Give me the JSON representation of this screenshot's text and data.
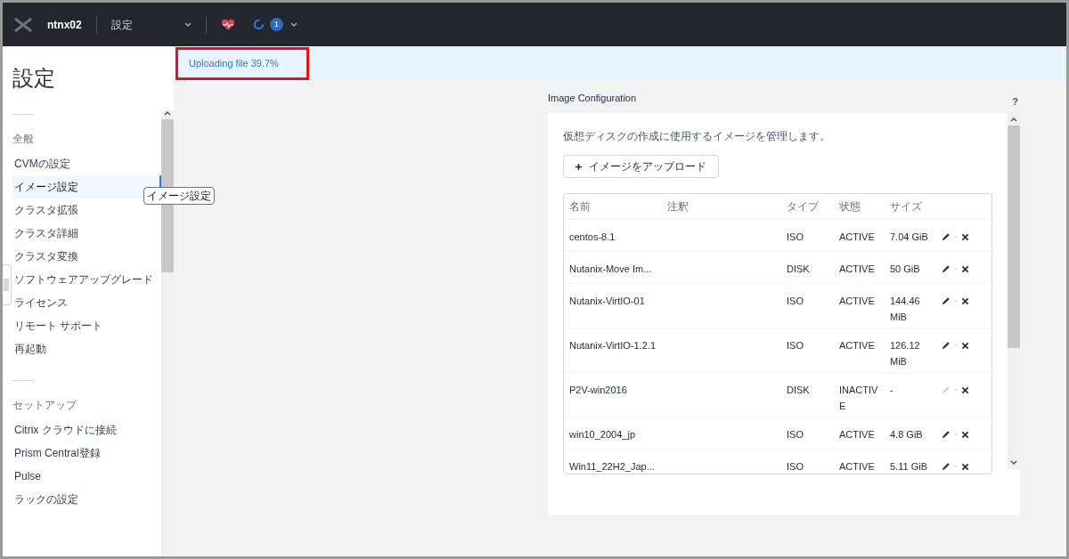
{
  "topbar": {
    "cluster": "ntnx02",
    "page": "設定",
    "alerts_count": "1"
  },
  "banner": {
    "text": "Uploading file 39.7%"
  },
  "sidebar": {
    "title": "設定",
    "tooltip": "イメージ設定",
    "sections": [
      {
        "heading": "全般",
        "items": [
          {
            "label": "CVMの設定",
            "selected": false
          },
          {
            "label": "イメージ設定",
            "selected": true
          },
          {
            "label": "クラスタ拡張",
            "selected": false
          },
          {
            "label": "クラスタ詳細",
            "selected": false
          },
          {
            "label": "クラスタ変換",
            "selected": false
          },
          {
            "label": "ソフトウェアアップグレード",
            "selected": false
          },
          {
            "label": "ライセンス",
            "selected": false
          },
          {
            "label": "リモート サポート",
            "selected": false
          },
          {
            "label": "再起動",
            "selected": false
          }
        ]
      },
      {
        "heading": "セットアップ",
        "items": [
          {
            "label": "Citrix クラウドに接続",
            "selected": false
          },
          {
            "label": "Prism Central登録",
            "selected": false
          },
          {
            "label": "Pulse",
            "selected": false
          },
          {
            "label": "ラックの設定",
            "selected": false
          }
        ]
      }
    ]
  },
  "panel": {
    "title": "Image Configuration",
    "help": "?",
    "description": "仮想ディスクの作成に使用するイメージを管理します。",
    "upload_button": "イメージをアップロード",
    "table": {
      "columns": [
        "名前",
        "注釈",
        "タイプ",
        "状態",
        "サイズ"
      ],
      "rows": [
        {
          "name": "centos-8.1",
          "type": "ISO",
          "state": "ACTIVE",
          "size": "7.04 GiB",
          "edit_disabled": false
        },
        {
          "name": "Nutanix-Move Im...",
          "type": "DISK",
          "state": "ACTIVE",
          "size": "50 GiB",
          "edit_disabled": false
        },
        {
          "name": "Nutanix-VirtIO-01",
          "type": "ISO",
          "state": "ACTIVE",
          "size": "144.46 MiB",
          "edit_disabled": false
        },
        {
          "name": "Nutanix-VirtIO-1.2.1",
          "type": "ISO",
          "state": "ACTIVE",
          "size": "126.12 MiB",
          "edit_disabled": false
        },
        {
          "name": "P2V-win2016",
          "type": "DISK",
          "state": "INACTIVE",
          "size": "-",
          "edit_disabled": true
        },
        {
          "name": "win10_2004_jp",
          "type": "ISO",
          "state": "ACTIVE",
          "size": "4.8 GiB",
          "edit_disabled": false
        },
        {
          "name": "Win11_22H2_Jap...",
          "type": "ISO",
          "state": "ACTIVE",
          "size": "5.11 GiB",
          "edit_disabled": false
        }
      ]
    }
  }
}
